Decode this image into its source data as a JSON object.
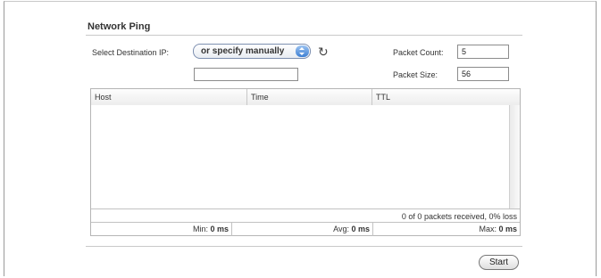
{
  "section": {
    "title": "Network Ping"
  },
  "destination": {
    "label": "Select Destination IP:",
    "selected_option": "or specify manually",
    "refresh_icon": "refresh-icon",
    "manual_ip_value": ""
  },
  "packet_count": {
    "label": "Packet Count:",
    "value": "5"
  },
  "packet_size": {
    "label": "Packet Size:",
    "value": "56"
  },
  "results": {
    "columns": [
      "Host",
      "Time",
      "TTL"
    ],
    "rows": [],
    "summary": "0 of 0 packets received, 0% loss",
    "min_label": "Min:",
    "min_value": "0 ms",
    "avg_label": "Avg:",
    "avg_value": "0 ms",
    "max_label": "Max:",
    "max_value": "0 ms"
  },
  "actions": {
    "start_label": "Start"
  },
  "colors": {
    "accent": "#3c7fd3",
    "border": "#b5b5b5"
  }
}
